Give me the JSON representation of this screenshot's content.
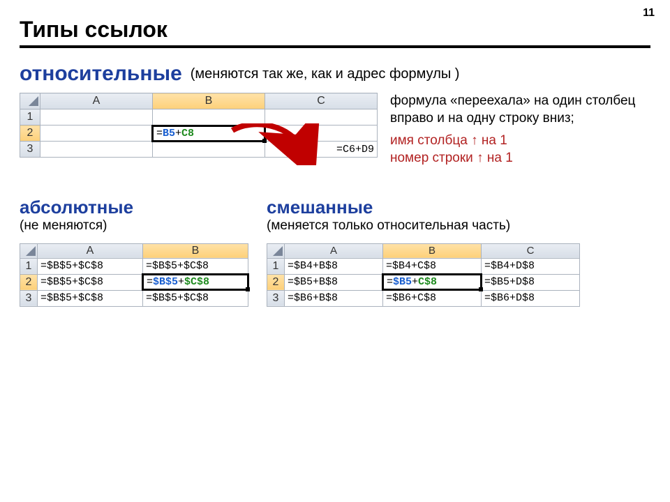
{
  "page_number": "11",
  "title": "Типы ссылок",
  "relative": {
    "term": "относительные",
    "paren": "(меняются так же, как и адрес формулы )",
    "note_line1": "формула «переехала» на один столбец вправо и на одну строку вниз;",
    "note_red": "имя столбца ↑ на 1\nномер строки ↑ на 1",
    "sheet": {
      "cols": [
        "A",
        "B",
        "C"
      ],
      "rows": [
        "1",
        "2",
        "3"
      ],
      "selected_col": "B",
      "selected_row": "2",
      "formula_sel_eq": "=",
      "formula_sel_a": "B5",
      "formula_sel_plus": "+",
      "formula_sel_b": "C8",
      "formula_next": "=C6+D9"
    }
  },
  "absolute": {
    "term": "абсолютные",
    "paren": "(не меняются)",
    "sheet": {
      "cols": [
        "A",
        "B"
      ],
      "rows": [
        "1",
        "2",
        "3"
      ],
      "cells": [
        [
          "=$B$5+$C$8",
          "=$B$5+$C$8"
        ],
        [
          "=$B$5+$C$8",
          "SEL"
        ],
        [
          "=$B$5+$C$8",
          "=$B$5+$C$8"
        ]
      ],
      "sel_eq": "=",
      "sel_a": "$B$5",
      "sel_plus": "+",
      "sel_b": "$C$8"
    }
  },
  "mixed": {
    "term": "смешанные",
    "paren": "(меняется только относительная часть)",
    "sheet": {
      "cols": [
        "A",
        "B",
        "C"
      ],
      "rows": [
        "1",
        "2",
        "3"
      ],
      "cells": [
        [
          "=$B4+B$8",
          "=$B4+C$8",
          "=$B4+D$8"
        ],
        [
          "=$B5+B$8",
          "SEL",
          "=$B5+D$8"
        ],
        [
          "=$B6+B$8",
          "=$B6+C$8",
          "=$B6+D$8"
        ]
      ],
      "sel_eq": "=",
      "sel_a": "$B5",
      "sel_plus": "+",
      "sel_b": "C$8"
    }
  }
}
